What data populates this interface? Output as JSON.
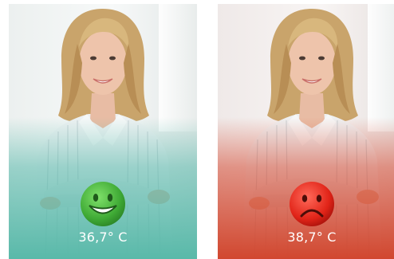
{
  "cards": [
    {
      "temperature": "36,7° C",
      "status": "normal",
      "emoji_icon": "smiley-face-icon",
      "accent_color": "#59b9a9"
    },
    {
      "temperature": "38,7° C",
      "status": "fever",
      "emoji_icon": "sad-face-icon",
      "accent_color": "#d1472f"
    }
  ]
}
